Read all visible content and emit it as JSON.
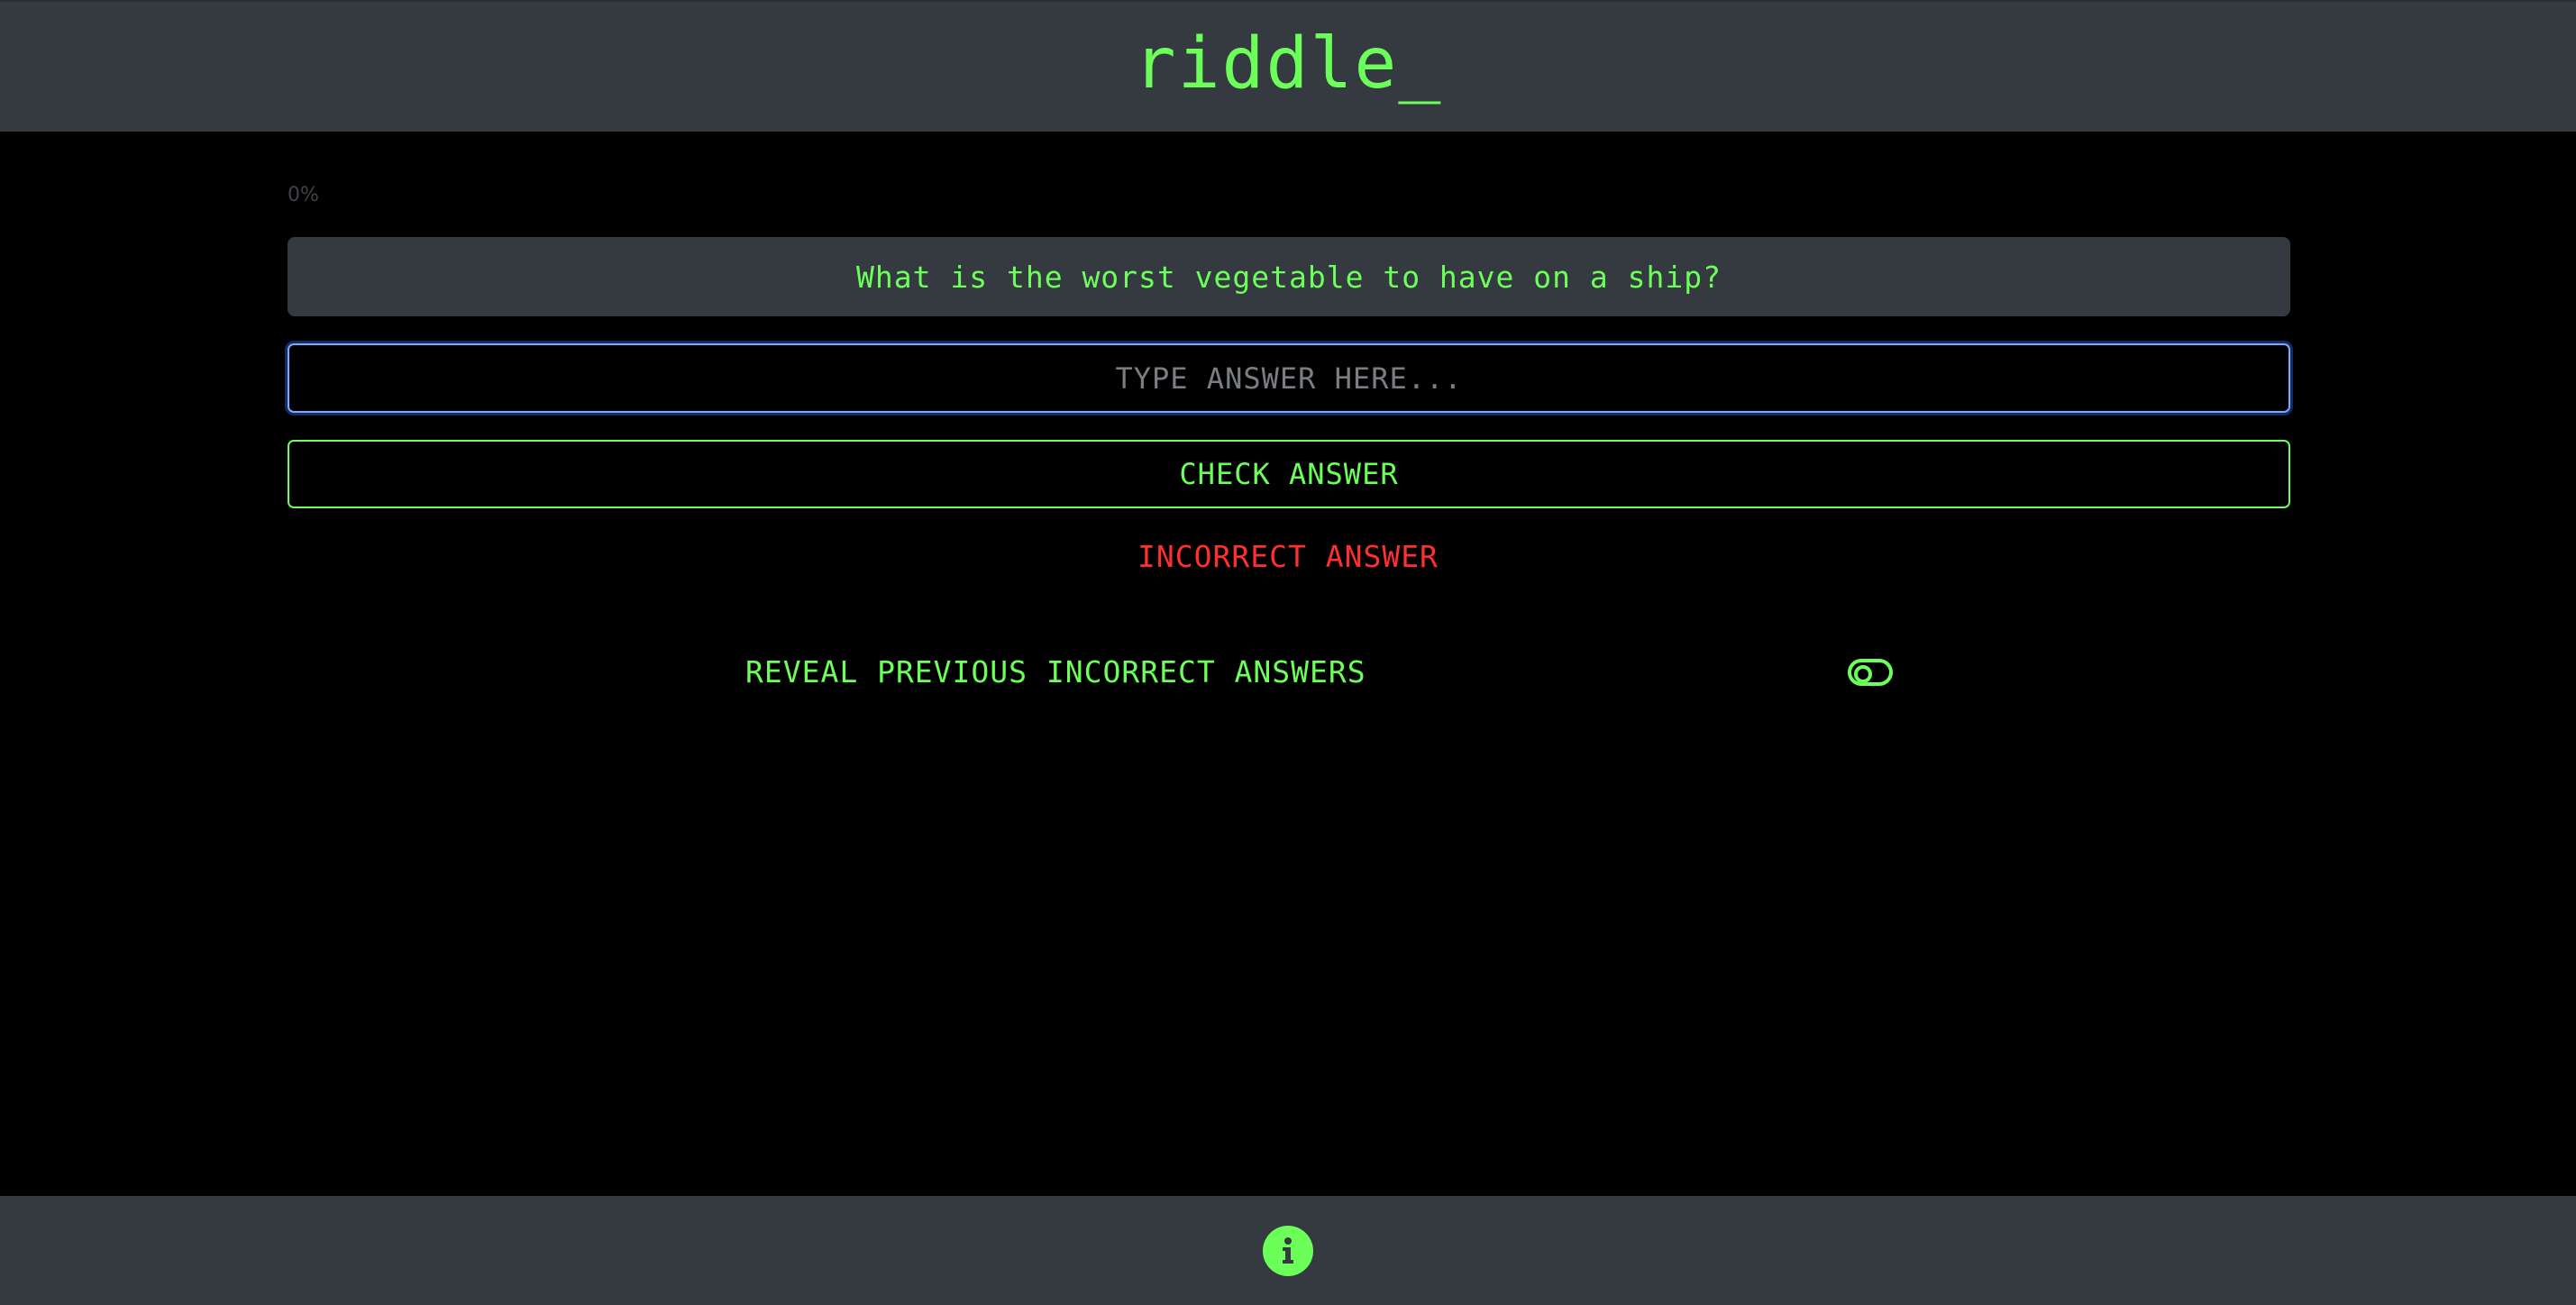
{
  "header": {
    "logo_text": "riddle_"
  },
  "progress": {
    "label": "0%",
    "value_percent": 0
  },
  "question": {
    "text": "What is the worst vegetable to have on a ship?"
  },
  "answer_input": {
    "placeholder": "TYPE ANSWER HERE...",
    "value": ""
  },
  "check_button": {
    "label": "CHECK ANSWER"
  },
  "feedback": {
    "message": "INCORRECT ANSWER"
  },
  "reveal": {
    "label": "REVEAL PREVIOUS INCORRECT ANSWERS",
    "toggle_on": false
  },
  "footer": {
    "info_icon": "info-circle-icon"
  },
  "colors": {
    "accent_green": "#6cff5a",
    "error_red": "#ff2f2f",
    "panel_gray": "#343a40",
    "focus_blue": "#7fa7ff"
  }
}
